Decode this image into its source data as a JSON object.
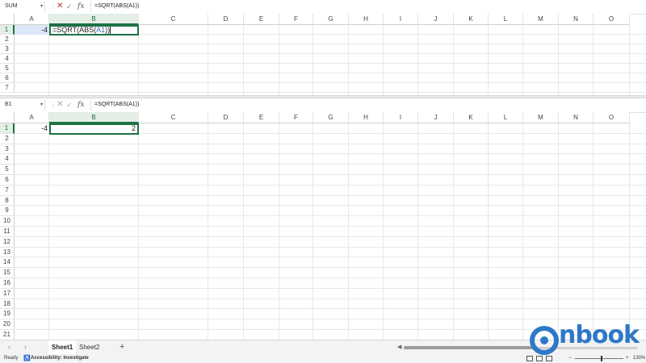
{
  "top": {
    "name_box": "SUM",
    "formula": "=SQRT(ABS(A1))",
    "cell_a1": "-4",
    "editing": {
      "prefix": "=SQRT(ABS(",
      "ref": "A1",
      "suffix": "))"
    }
  },
  "bottom": {
    "name_box": "B1",
    "formula": "=SQRT(ABS(A1))",
    "cell_a1": "-4",
    "cell_b1": "2"
  },
  "columns": [
    "A",
    "B",
    "C",
    "D",
    "E",
    "F",
    "G",
    "H",
    "I",
    "J",
    "K",
    "L",
    "M",
    "N",
    "O"
  ],
  "top_rows": [
    "1",
    "2",
    "3",
    "4",
    "5",
    "6",
    "7"
  ],
  "bottom_rows": [
    "1",
    "2",
    "3",
    "4",
    "5",
    "6",
    "7",
    "8",
    "9",
    "10",
    "11",
    "12",
    "13",
    "14",
    "15",
    "16",
    "17",
    "18",
    "19",
    "20",
    "21"
  ],
  "formula_icons": {
    "cancel": "✕",
    "enter": "✓",
    "fx": "fx"
  },
  "tabs": {
    "prev": "‹",
    "next": "›",
    "sheet1": "Sheet1",
    "sheet2": "Sheet2",
    "add": "+"
  },
  "status": {
    "ready": "Ready",
    "accessibility": "Accessibility: Investigate",
    "zoom": "130%",
    "minus": "−",
    "plus": "+"
  },
  "brand": {
    "logo_text": "nbook",
    "color": "#2e78c8"
  },
  "colors": {
    "accent": "#1e7145",
    "header_active": "#e3efe6"
  }
}
